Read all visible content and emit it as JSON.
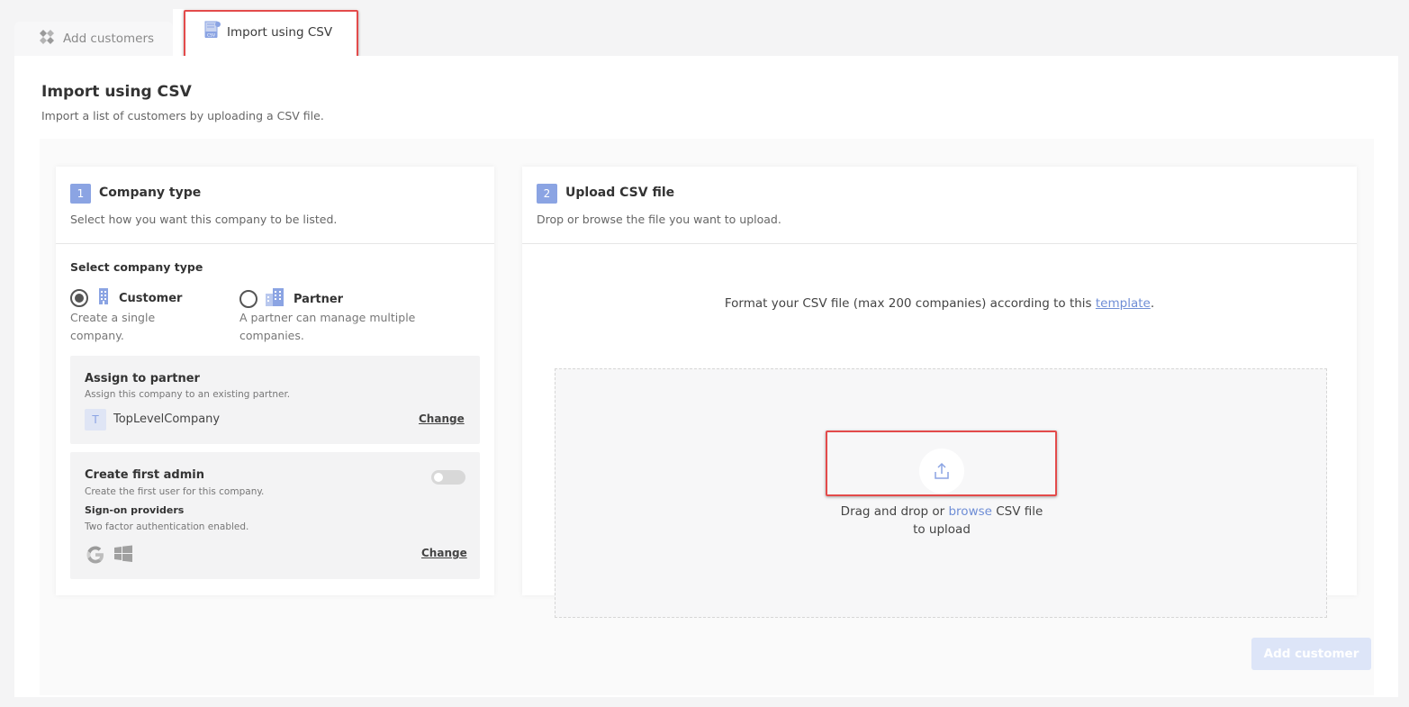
{
  "tabs": [
    {
      "label": "Add customers",
      "icon": "puzzle-icon"
    },
    {
      "label": "Import using CSV",
      "icon": "csv-file-icon"
    }
  ],
  "page": {
    "title": "Import using CSV",
    "subtitle": "Import a list of customers by uploading a CSV file."
  },
  "step1": {
    "number": "1",
    "title": "Company type",
    "subtitle": "Select how you want this company to be listed.",
    "select_label": "Select company type",
    "options": [
      {
        "label": "Customer",
        "desc_line1": "Create a single",
        "desc_line2": "company.",
        "selected": true,
        "icon": "building-icon"
      },
      {
        "label": "Partner",
        "desc_line1": "A partner can manage multiple",
        "desc_line2": "companies.",
        "selected": false,
        "icon": "buildings-icon"
      }
    ],
    "assign": {
      "title": "Assign to partner",
      "subtitle": "Assign this company to an existing partner.",
      "avatar_letter": "T",
      "company": "TopLevelCompany",
      "change_label": "Change"
    },
    "admin": {
      "title": "Create first admin",
      "subtitle": "Create the first user for this company.",
      "providers_title": "Sign-on providers",
      "providers_sub": "Two factor authentication enabled.",
      "change_label": "Change",
      "toggle_on": false
    }
  },
  "step2": {
    "number": "2",
    "title": "Upload CSV file",
    "subtitle": "Drop or browse the file you want to upload.",
    "format_prefix": "Format your CSV file (max 200 companies) according to this ",
    "template_link": "template",
    "format_suffix": ".",
    "drop_prefix": "Drag and drop or ",
    "browse_link": "browse",
    "drop_suffix": " CSV file",
    "drop_line2": "to upload"
  },
  "footer": {
    "add_button": "Add customer"
  },
  "colors": {
    "accent": "#8ba4e3",
    "link": "#6f8ed6",
    "highlight": "#e34b4b"
  }
}
